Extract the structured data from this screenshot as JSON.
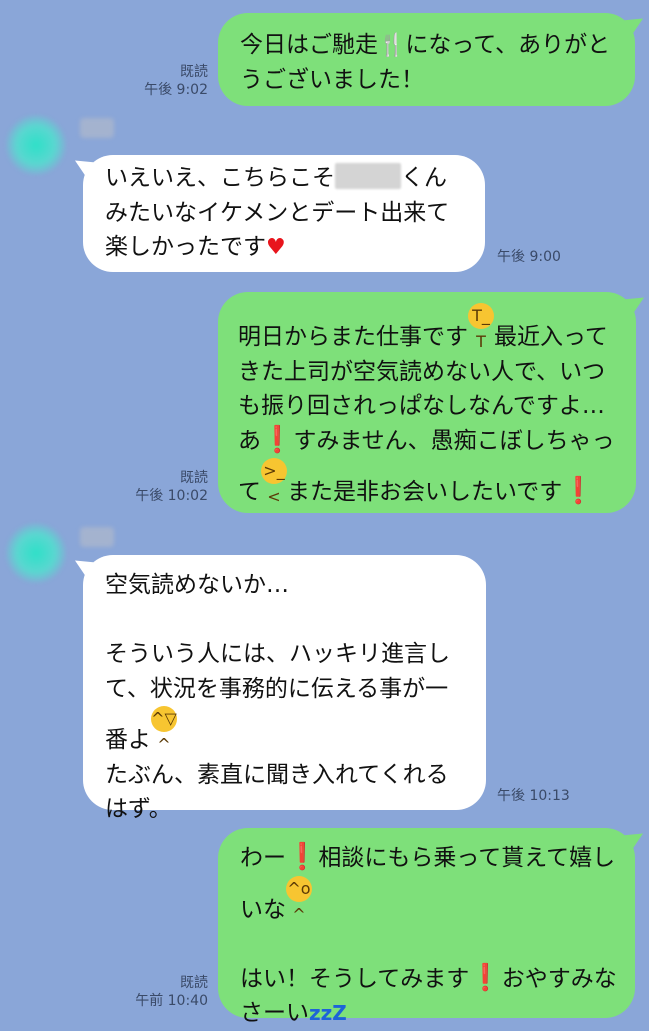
{
  "messages": [
    {
      "id": "m1",
      "dir": "out",
      "parts": [
        "今日はご馳走",
        {
          "emoji": "fork-knife-icon",
          "glyph": "🍴"
        },
        "になって、ありがとうございました！"
      ],
      "read": "既読",
      "time": "午後 9:02"
    },
    {
      "id": "m2",
      "dir": "in",
      "parts": [
        "いえいえ、こちらこそ",
        {
          "redact": "name-redaction"
        },
        "くんみたいなイケメンとデート出来て楽しかったです",
        {
          "emoji": "heart-icon",
          "glyph": "♥"
        }
      ],
      "time": "午後 9:00"
    },
    {
      "id": "m3",
      "dir": "out",
      "parts": [
        "明日からまた仕事です",
        {
          "emoji": "crying-face-icon",
          "glyph": "T_T"
        },
        "最近入ってきた上司が空気読めない人で、いつも振り回されっぱなしなんですよ…あ",
        {
          "emoji": "exclamation-icon",
          "glyph": "❗"
        },
        "すみません、愚痴こぼしちゃって",
        {
          "emoji": "disappointed-face-icon",
          "glyph": ">_<"
        },
        "また是非お会いしたいです",
        {
          "emoji": "exclamation-icon",
          "glyph": "❗"
        }
      ],
      "read": "既読",
      "time": "午後 10:02"
    },
    {
      "id": "m4",
      "dir": "in",
      "parts": [
        "空気読めないか…\n\nそういう人には、ハッキリ進言して、状況を事務的に伝える事が一番よ",
        {
          "emoji": "grinning-face-icon",
          "glyph": "^▽^"
        },
        "\nたぶん、素直に聞き入れてくれるはず。"
      ],
      "time": "午後 10:13"
    },
    {
      "id": "m5",
      "dir": "out",
      "parts": [
        "わー",
        {
          "emoji": "exclamation-icon",
          "glyph": "❗"
        },
        "相談にもら乗って貰えて嬉しいな",
        {
          "emoji": "laughing-face-icon",
          "glyph": "^o^"
        },
        "\n\nはい！そうしてみます",
        {
          "emoji": "exclamation-icon",
          "glyph": "❗"
        },
        "おやすみなさーい",
        {
          "emoji": "sleeping-zzz-icon",
          "glyph": "zzZ"
        }
      ],
      "read": "既読",
      "time": "午前 10:40"
    }
  ],
  "colors": {
    "background": "#8aa6d8",
    "outgoing_bubble": "#7ee07a",
    "incoming_bubble": "#ffffff"
  }
}
